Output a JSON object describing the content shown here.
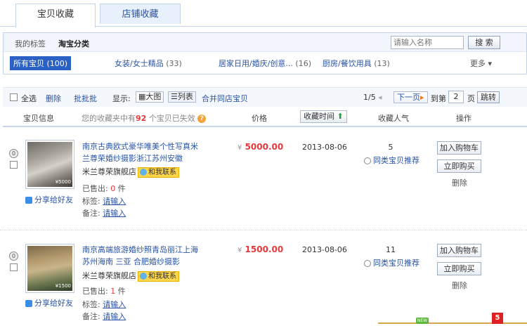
{
  "tabs": [
    {
      "label": "宝贝收藏"
    },
    {
      "label": "店铺收藏"
    }
  ],
  "filter": {
    "tabs": [
      {
        "label": "我的标签"
      },
      {
        "label": "淘宝分类"
      }
    ],
    "search_placeholder": "请输入名称",
    "search_button": "搜 索",
    "categories": [
      {
        "name": "所有宝贝",
        "count": "(100)"
      },
      {
        "name": "女装/女士精品",
        "count": "(33)"
      },
      {
        "name": "居家日用/婚庆/创意...",
        "count": "(16)"
      },
      {
        "name": "厨房/餐饮用具",
        "count": "(13)"
      }
    ],
    "more": "更多"
  },
  "toolbar": {
    "select_all": "全选",
    "delete": "删除",
    "batch": "批批批",
    "display_label": "显示:",
    "view_large": "大图",
    "view_list": "列表",
    "merge": "合并同店宝贝",
    "page_info": "1/5",
    "next_page": "下一页",
    "goto_prefix": "到第",
    "page_value": "2",
    "goto_suffix": "页",
    "jump": "跳转"
  },
  "header": {
    "info": "宝贝信息",
    "notice_prefix": "您的收藏夹中有",
    "notice_count": "92",
    "notice_suffix": "个宝贝已失效",
    "price": "价格",
    "time": "收藏时间",
    "popularity": "收藏人气",
    "action": "操作"
  },
  "items": [
    {
      "rank": "0",
      "title": "南京古典欧式豪华唯美个性写真米兰尊荣婚纱摄影浙江苏州安徽",
      "shop": "米兰尊荣旗舰店",
      "contact": "和我联系",
      "sold_label": "已售出:",
      "sold_value": "0",
      "sold_unit": "件",
      "tag_label": "标签:",
      "tag_value": "请输入",
      "note_label": "备注:",
      "note_value": "请输入",
      "price_symbol": "¥",
      "price": "5000.00",
      "date": "2013-08-06",
      "count": "5",
      "recommend": "同类宝贝推荐",
      "add_cart": "加入购物车",
      "buy_now": "立即购买",
      "delete": "删除",
      "share": "分享给好友",
      "thumb_tag": "¥5000",
      "colors": {
        "top": "#6d6a66",
        "mid": "#d4d0ca",
        "bottom": "#3c3a38"
      }
    },
    {
      "rank": "0",
      "title": "南京高端旅游婚纱照青岛丽江上海苏州海南 三亚 合肥婚纱摄影",
      "shop": "米兰尊荣旗舰店",
      "contact": "和我联系",
      "sold_label": "已售出:",
      "sold_value": "1",
      "sold_unit": "件",
      "tag_label": "标签:",
      "tag_value": "请输入",
      "note_label": "备注:",
      "note_value": "请输入",
      "price_symbol": "¥",
      "price": "1500.00",
      "date": "2013-08-06",
      "count": "11",
      "recommend": "同类宝贝推荐",
      "add_cart": "加入购物车",
      "buy_now": "立即购买",
      "delete": "删除",
      "share": "分享给好友",
      "thumb_tag": "¥1500",
      "colors": {
        "top": "#7b6a4a",
        "mid": "#c9b48a",
        "bottom": "#2f3b29"
      }
    }
  ],
  "bottom": {
    "new_badge": "NEW",
    "message_count": "5"
  },
  "colors": {
    "accent": "#2b61c5",
    "link": "#2953a6",
    "price": "#e4393c"
  }
}
